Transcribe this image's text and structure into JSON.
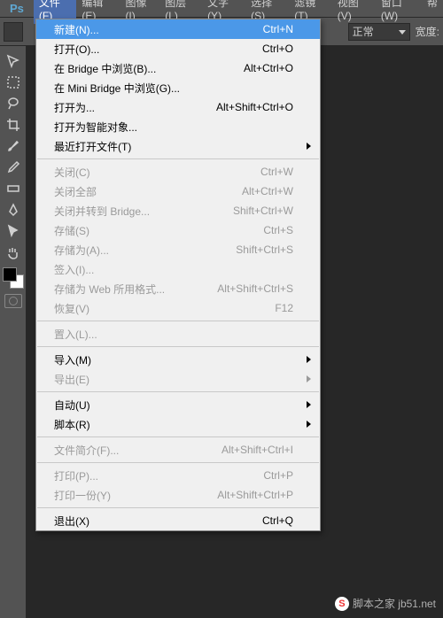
{
  "menubar": {
    "items": [
      "文件(F)",
      "编辑(E)",
      "图像(I)",
      "图层(L)",
      "文字(Y)",
      "选择(S)",
      "滤镜(T)",
      "视图(V)",
      "窗口(W)",
      "帮"
    ]
  },
  "optbar": {
    "mode_label": "正常",
    "width_label": "宽度:"
  },
  "dropdown": {
    "items": [
      {
        "t": "item",
        "label": "新建(N)...",
        "shortcut": "Ctrl+N",
        "hi": true
      },
      {
        "t": "item",
        "label": "打开(O)...",
        "shortcut": "Ctrl+O"
      },
      {
        "t": "item",
        "label": "在 Bridge 中浏览(B)...",
        "shortcut": "Alt+Ctrl+O"
      },
      {
        "t": "item",
        "label": "在 Mini Bridge 中浏览(G)..."
      },
      {
        "t": "item",
        "label": "打开为...",
        "shortcut": "Alt+Shift+Ctrl+O"
      },
      {
        "t": "item",
        "label": "打开为智能对象..."
      },
      {
        "t": "item",
        "label": "最近打开文件(T)",
        "sub": true
      },
      {
        "t": "sep"
      },
      {
        "t": "item",
        "label": "关闭(C)",
        "shortcut": "Ctrl+W",
        "dis": true
      },
      {
        "t": "item",
        "label": "关闭全部",
        "shortcut": "Alt+Ctrl+W",
        "dis": true
      },
      {
        "t": "item",
        "label": "关闭并转到 Bridge...",
        "shortcut": "Shift+Ctrl+W",
        "dis": true
      },
      {
        "t": "item",
        "label": "存储(S)",
        "shortcut": "Ctrl+S",
        "dis": true
      },
      {
        "t": "item",
        "label": "存储为(A)...",
        "shortcut": "Shift+Ctrl+S",
        "dis": true
      },
      {
        "t": "item",
        "label": "签入(I)...",
        "dis": true
      },
      {
        "t": "item",
        "label": "存储为 Web 所用格式...",
        "shortcut": "Alt+Shift+Ctrl+S",
        "dis": true
      },
      {
        "t": "item",
        "label": "恢复(V)",
        "shortcut": "F12",
        "dis": true
      },
      {
        "t": "sep"
      },
      {
        "t": "item",
        "label": "置入(L)...",
        "dis": true
      },
      {
        "t": "sep"
      },
      {
        "t": "item",
        "label": "导入(M)",
        "sub": true
      },
      {
        "t": "item",
        "label": "导出(E)",
        "sub": true,
        "dis": true
      },
      {
        "t": "sep"
      },
      {
        "t": "item",
        "label": "自动(U)",
        "sub": true
      },
      {
        "t": "item",
        "label": "脚本(R)",
        "sub": true
      },
      {
        "t": "sep"
      },
      {
        "t": "item",
        "label": "文件简介(F)...",
        "shortcut": "Alt+Shift+Ctrl+I",
        "dis": true
      },
      {
        "t": "sep"
      },
      {
        "t": "item",
        "label": "打印(P)...",
        "shortcut": "Ctrl+P",
        "dis": true
      },
      {
        "t": "item",
        "label": "打印一份(Y)",
        "shortcut": "Alt+Shift+Ctrl+P",
        "dis": true
      },
      {
        "t": "sep"
      },
      {
        "t": "item",
        "label": "退出(X)",
        "shortcut": "Ctrl+Q"
      }
    ]
  },
  "watermark": {
    "text": "脚本之家",
    "domain": "jb51.net"
  },
  "logo": "Ps"
}
